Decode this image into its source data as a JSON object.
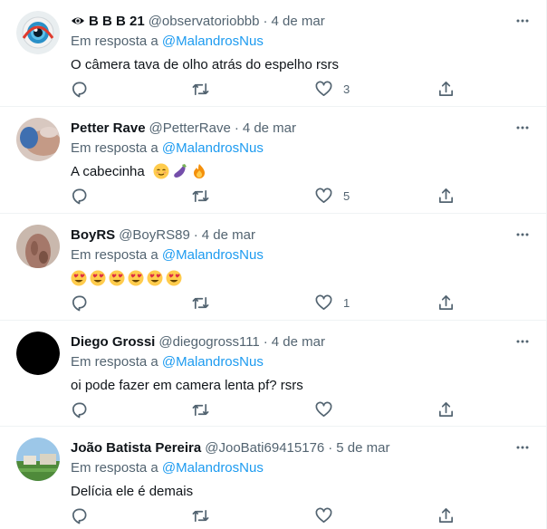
{
  "tweets": [
    {
      "name": "B B B 21",
      "name_icon": "eye-icon",
      "handle": "@observatoriobbb",
      "separator": "·",
      "date": "4 de mar",
      "replying_prefix": "Em resposta a",
      "replying_to": "@MalandrosNus",
      "text": "O câmera tava de olho atrás do espelho rsrs",
      "emojis": [],
      "likes": "3",
      "avatar": "big-eye-avatar"
    },
    {
      "name": "Petter Rave",
      "handle": "@PetterRave",
      "separator": "·",
      "date": "4 de mar",
      "replying_prefix": "Em resposta a",
      "replying_to": "@MalandrosNus",
      "text": "A cabecinha",
      "emojis": [
        "relieved-face-emoji",
        "eggplant-emoji",
        "fire-emoji"
      ],
      "likes": "5",
      "avatar": "photo-avatar"
    },
    {
      "name": "BoyRS",
      "handle": "@BoyRS89",
      "separator": "·",
      "date": "4 de mar",
      "replying_prefix": "Em resposta a",
      "replying_to": "@MalandrosNus",
      "text": "",
      "emojis": [
        "heart-eyes-emoji",
        "heart-eyes-emoji",
        "heart-eyes-emoji",
        "heart-eyes-emoji",
        "heart-eyes-emoji",
        "heart-eyes-emoji"
      ],
      "likes": "1",
      "avatar": "photo-avatar"
    },
    {
      "name": "Diego Grossi",
      "handle": "@diegogross111",
      "separator": "·",
      "date": "4 de mar",
      "replying_prefix": "Em resposta a",
      "replying_to": "@MalandrosNus",
      "text": "oi pode fazer em camera lenta pf? rsrs",
      "emojis": [],
      "likes": "",
      "avatar": "black-avatar"
    },
    {
      "name": "João Batista Pereira",
      "handle": "@JooBati69415176",
      "separator": "·",
      "date": "5 de mar",
      "replying_prefix": "Em resposta a",
      "replying_to": "@MalandrosNus",
      "text": "Delícia ele é demais",
      "emojis": [],
      "likes": "",
      "avatar": "landscape-avatar"
    }
  ],
  "colors": {
    "link": "#1d9bf0",
    "secondary_text": "#536471",
    "primary_text": "#0f1419",
    "divider": "#eff3f4"
  }
}
